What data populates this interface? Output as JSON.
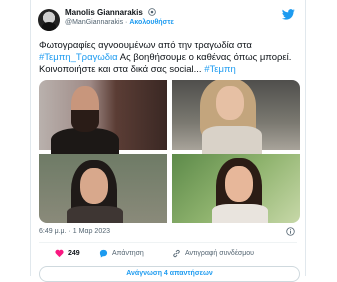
{
  "author": {
    "name": "Manolis Giannarakis",
    "handle": "@ManGiannarakis",
    "separator": "·",
    "follow_label": "Ακολουθήστε"
  },
  "tweet": {
    "text_part1": "Φωτογραφίες αγνοουμένων από την τραγωδία στα ",
    "hashtag1": "#Τεμπη_Τραγωδια",
    "text_part2": " Ας βοηθήσουμε ο καθένας όπως μπορεί. Κοινοποιήστε και στα δικά σας social... ",
    "hashtag2": "#Τεμπη"
  },
  "meta": {
    "time": "6:49 μ.μ.",
    "separator": "·",
    "date": "1 Μαρ 2023"
  },
  "actions": {
    "likes": "249",
    "reply_label": "Απάντηση",
    "copy_link_label": "Αντιγραφή συνδέσμου"
  },
  "replies_button": "Ανάγνωση 4 απαντήσεων",
  "colors": {
    "accent": "#1d9bf0",
    "like": "#f91880",
    "text": "#0f1419",
    "muted": "#536471"
  }
}
